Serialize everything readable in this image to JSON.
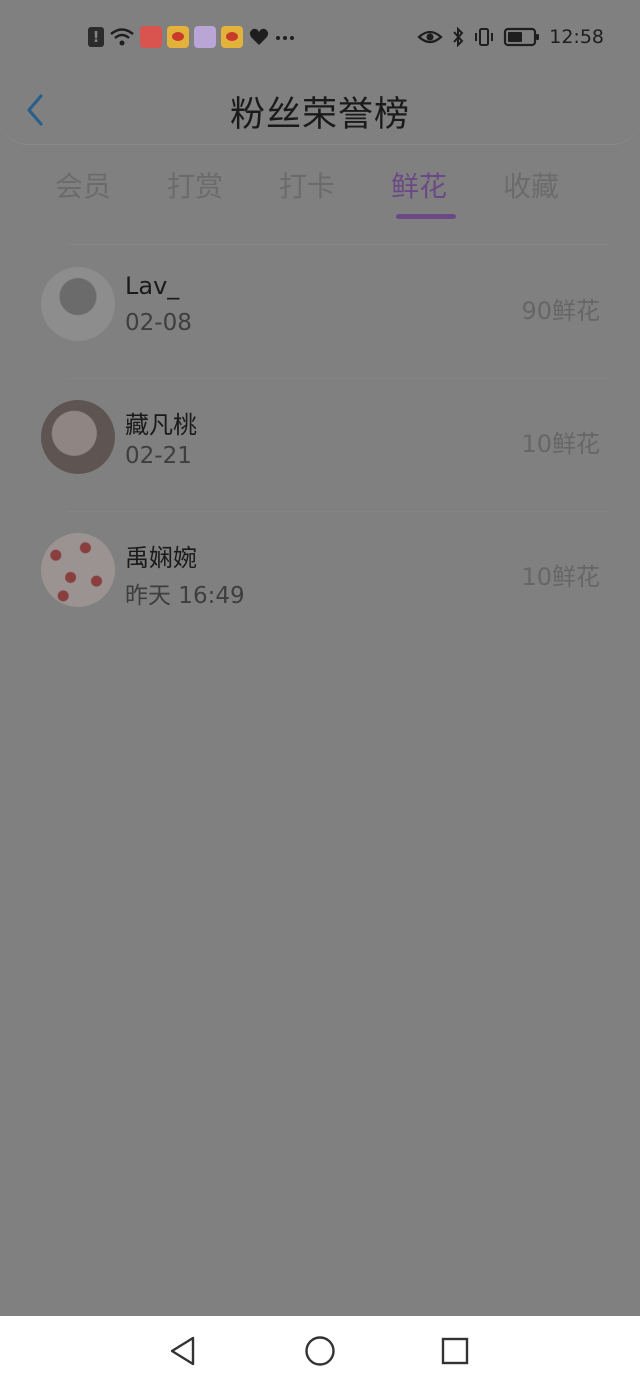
{
  "status_bar": {
    "time": "12:58",
    "left_icons": [
      "alert-icon",
      "wifi-icon",
      "app-store-icon",
      "weibo-icon",
      "cat-app-icon",
      "weibo-icon",
      "heart-app-icon",
      "more-icon"
    ],
    "right_icons": [
      "eye-icon",
      "bluetooth-icon",
      "vibrate-icon",
      "battery-icon"
    ]
  },
  "header": {
    "title": "粉丝荣誉榜",
    "back_icon": "chevron-left-icon"
  },
  "tabs": [
    {
      "label": "会员",
      "active": false
    },
    {
      "label": "打赏",
      "active": false
    },
    {
      "label": "打卡",
      "active": false
    },
    {
      "label": "鲜花",
      "active": true
    },
    {
      "label": "收藏",
      "active": false
    }
  ],
  "list": [
    {
      "name": "Lav_",
      "time": "02-08",
      "amount": "90鲜花"
    },
    {
      "name": "藏凡桃",
      "time": "02-21",
      "amount": "10鲜花"
    },
    {
      "name": "禹娴婉",
      "time": "昨天 16:49",
      "amount": "10鲜花"
    }
  ],
  "nav_bar": {
    "icons": [
      "back-triangle-icon",
      "home-circle-icon",
      "recents-square-icon"
    ]
  },
  "colors": {
    "accent": "#6a4a85",
    "back_arrow": "#2a5f8a",
    "overlay": "#808080"
  }
}
